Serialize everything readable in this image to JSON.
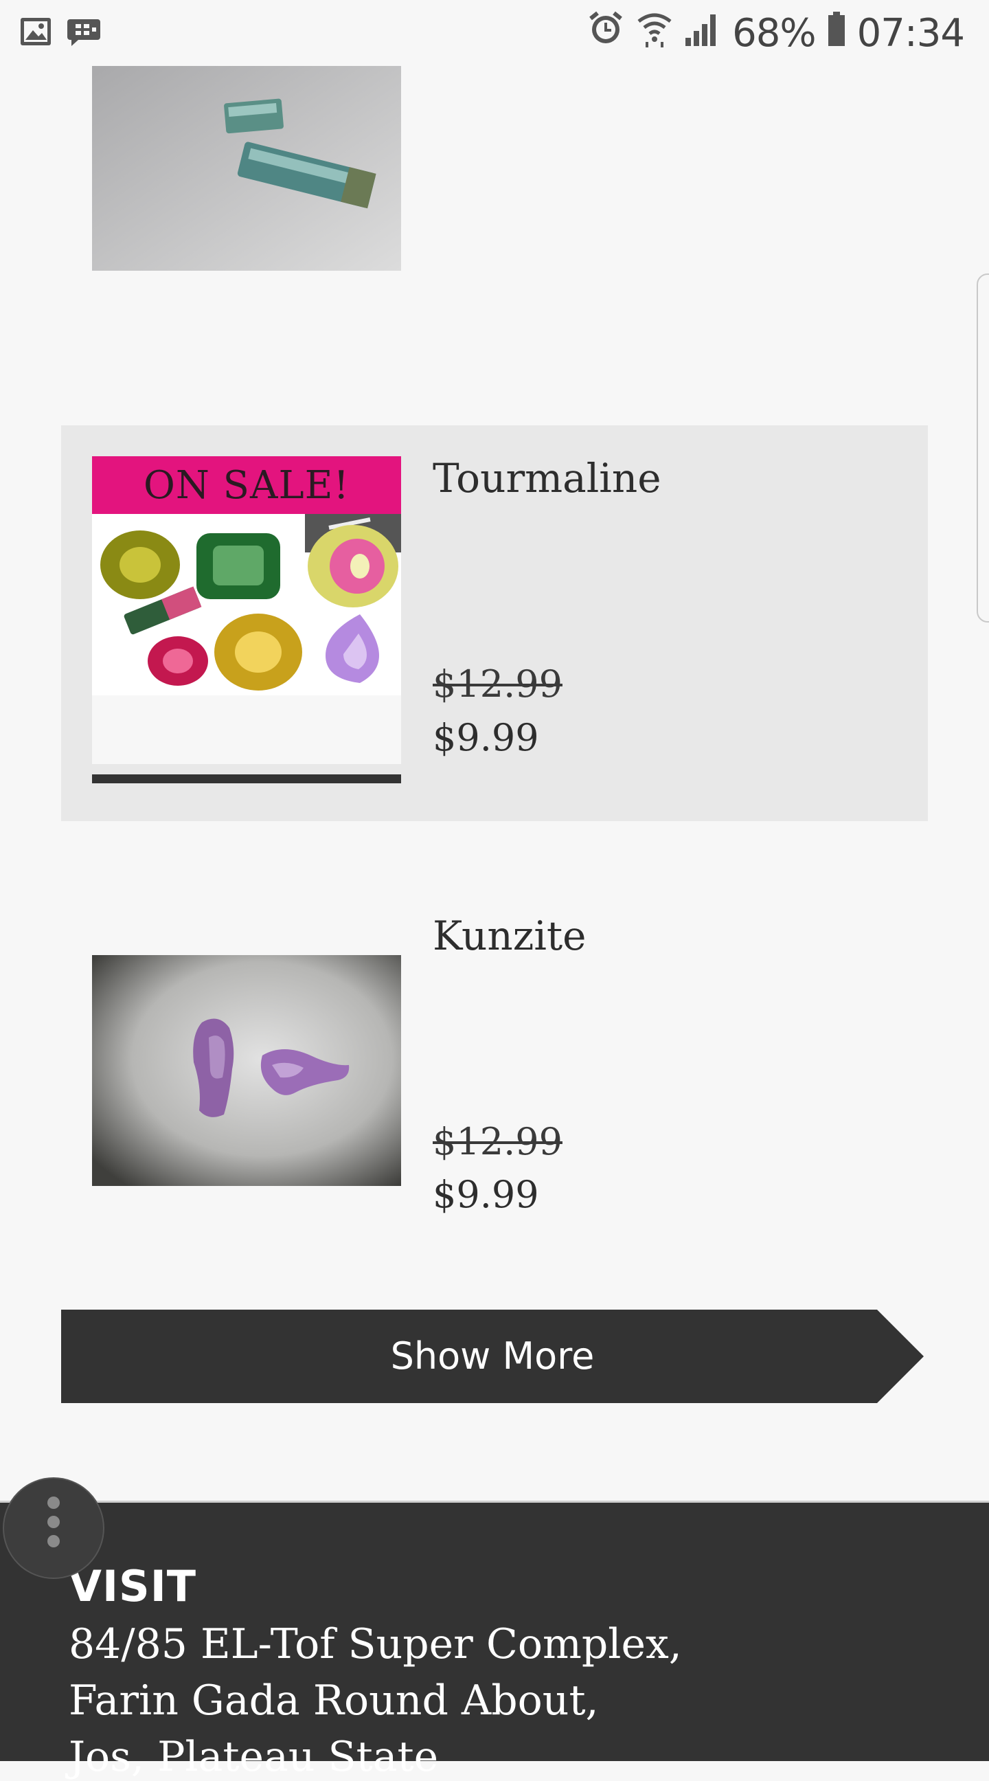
{
  "status_bar": {
    "battery": "68%",
    "time": "07:34",
    "icons": [
      "gallery-icon",
      "bbm-icon",
      "alarm-icon",
      "wifi-icon",
      "signal-icon",
      "battery-icon"
    ]
  },
  "products": [
    {
      "name": "",
      "image": "tourmaline-crystals-photo"
    },
    {
      "name": "Tourmaline",
      "badge": "ON SALE!",
      "old_price": "$12.99",
      "price": "$9.99",
      "image": "assorted-gemstones-photo",
      "highlighted": true
    },
    {
      "name": "Kunzite",
      "old_price": "$12.99",
      "price": "$9.99",
      "image": "kunzite-crystals-photo"
    }
  ],
  "show_more": {
    "label": "Show More"
  },
  "footer": {
    "heading": "VISIT",
    "address_lines": [
      "84/85 EL-Tof Super Complex,",
      "Farin Gada Round About,",
      "Jos, Plateau State"
    ]
  },
  "colors": {
    "sale_badge": "#e3147e",
    "dark": "#333333",
    "highlight_bg": "#e8e8e8",
    "page_bg": "#f7f7f7"
  }
}
